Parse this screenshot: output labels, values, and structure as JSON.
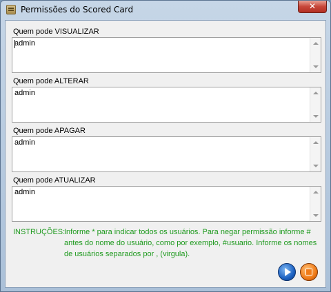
{
  "window": {
    "title": "Permissões do Scored Card",
    "close_glyph": "✕"
  },
  "fields": [
    {
      "label": "Quem pode VISUALIZAR",
      "value": "admin"
    },
    {
      "label": "Quem pode ALTERAR",
      "value": "admin"
    },
    {
      "label": "Quem pode APAGAR",
      "value": "admin"
    },
    {
      "label": "Quem pode ATUALIZAR",
      "value": "admin"
    }
  ],
  "instructions": {
    "label": "INSTRUÇÕES:",
    "text": "Informe * para indicar todos os usuários. Para negar permissão informe  # antes do nome do usuário, como por exemplo, #usuario. Informe os nomes de usuários separados por , (virgula)."
  },
  "icons": {
    "window": "scorecard-app-icon",
    "ok": "play-arrow-icon",
    "cancel": "stop-square-icon"
  },
  "colors": {
    "instructions_text": "#1f9a1f",
    "ok_button": "#1d62c2",
    "cancel_button": "#f07b17",
    "close_button": "#c7473a"
  }
}
